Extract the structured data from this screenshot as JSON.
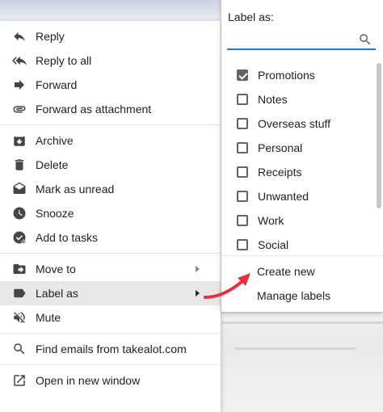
{
  "menu": {
    "groups": [
      [
        {
          "label": "Reply",
          "icon": "reply-icon"
        },
        {
          "label": "Reply to all",
          "icon": "reply-all-icon"
        },
        {
          "label": "Forward",
          "icon": "forward-icon"
        },
        {
          "label": "Forward as attachment",
          "icon": "attachment-icon"
        }
      ],
      [
        {
          "label": "Archive",
          "icon": "archive-icon"
        },
        {
          "label": "Delete",
          "icon": "trash-icon"
        },
        {
          "label": "Mark as unread",
          "icon": "mark-unread-icon"
        },
        {
          "label": "Snooze",
          "icon": "clock-icon"
        },
        {
          "label": "Add to tasks",
          "icon": "add-task-icon"
        }
      ],
      [
        {
          "label": "Move to",
          "icon": "move-to-icon"
        },
        {
          "label": "Label as",
          "icon": "label-icon"
        },
        {
          "label": "Mute",
          "icon": "mute-icon"
        }
      ],
      [
        {
          "label": "Find emails from takealot.com",
          "icon": "search-icon"
        }
      ],
      [
        {
          "label": "Open in new window",
          "icon": "open-new-window-icon"
        }
      ]
    ]
  },
  "label_menu": {
    "title": "Label as:",
    "search": {
      "value": "",
      "placeholder": ""
    },
    "labels": [
      {
        "name": "Promotions",
        "checked": true
      },
      {
        "name": "Notes",
        "checked": false
      },
      {
        "name": "Overseas stuff",
        "checked": false
      },
      {
        "name": "Personal",
        "checked": false
      },
      {
        "name": "Receipts",
        "checked": false
      },
      {
        "name": "Unwanted",
        "checked": false
      },
      {
        "name": "Work",
        "checked": false
      },
      {
        "name": "Social",
        "checked": false
      }
    ],
    "create_new": "Create new",
    "manage_labels": "Manage labels"
  },
  "colors": {
    "accent": "#1a73e8",
    "annotation_arrow": "#e8303a",
    "active_row": "#e8e8e8"
  }
}
